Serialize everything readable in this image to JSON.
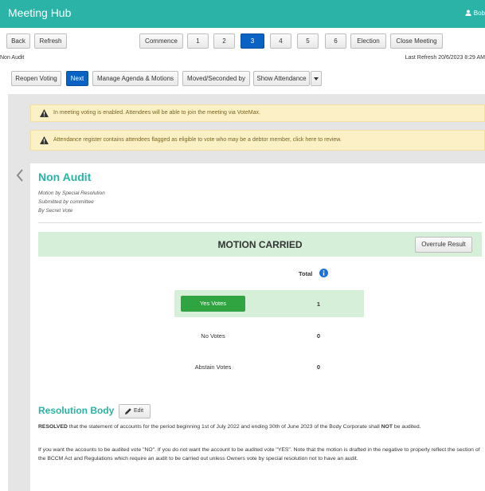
{
  "app": {
    "title": "Meeting Hub",
    "user": "Bob"
  },
  "nav": {
    "back": "Back",
    "refresh": "Refresh",
    "commence": "Commence",
    "items": [
      "1",
      "2",
      "3",
      "4",
      "5",
      "6"
    ],
    "active_item": "3",
    "election": "Election",
    "close_meeting": "Close Meeting"
  },
  "breadcrumb": "Non Audit",
  "last_refresh": "Last Refresh 20/6/2023 8:29 AM",
  "toolbar": {
    "reopen_voting": "Reopen Voting",
    "next": "Next",
    "manage_agenda": "Manage Agenda & Motions",
    "moved_seconded": "Moved/Seconded by",
    "show_attendance": "Show Attendance"
  },
  "alerts": [
    "In meeting voting is enabled. Attendees will be able to join the meeting via VoteMax.",
    "Attendance register contains attendees flagged as eligible to vote who may be a debtor member, click here to review."
  ],
  "motion": {
    "title": "Non Audit",
    "type": "Motion by Special Resolution",
    "submitted": "Submitted by committee",
    "vote_method": "By Secret Vote",
    "result": "MOTION CARRIED",
    "overrule_label": "Overrule Result"
  },
  "votes": {
    "total_header": "Total",
    "rows": [
      {
        "label": "Yes Votes",
        "count": "1"
      },
      {
        "label": "No Votes",
        "count": "0"
      },
      {
        "label": "Abstain Votes",
        "count": "0"
      }
    ]
  },
  "resolution": {
    "title": "Resolution Body",
    "edit_label": "Edit",
    "p1_bold": "RESOLVED",
    "p1_mid": " that the statement of accounts for the period beginning 1st of July 2022 and ending 30th of June 2023 of the Body Corporate shall ",
    "p1_not": "NOT",
    "p1_end": " be audited.",
    "p2": "If you want the accounts to be audited vote \"NO\". If you do not want the account to be audited vote \"YES\". Note that the motion is drafted in the negative to properly reflect the section of the BCCM Act and Regulations which require an audit to be carried out unless Owners vote by special resolution not to have an audit."
  },
  "colors": {
    "brand": "#2ab3a6",
    "active": "#0a63c4",
    "success": "#31a442",
    "carried_bg": "#d6efd9",
    "alert_bg": "#fcf1c6"
  }
}
